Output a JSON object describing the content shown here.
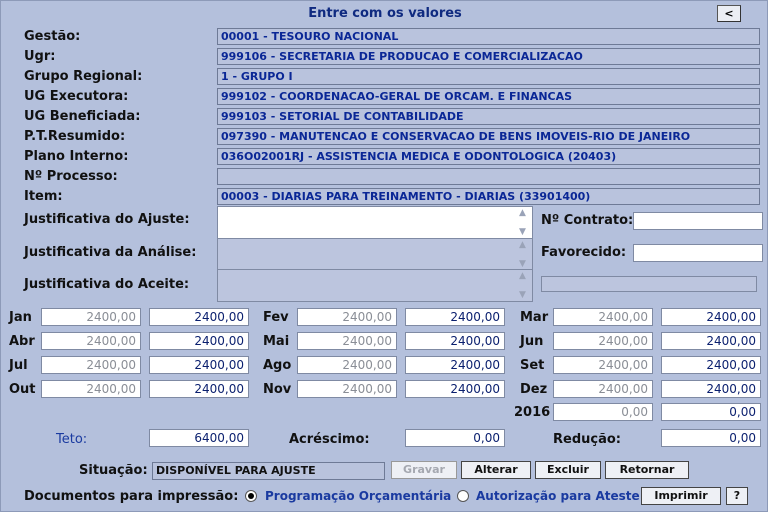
{
  "title": "Entre com os valores",
  "back_label": "<",
  "fields": [
    {
      "label": "Gestão:",
      "value": "00001 - TESOURO NACIONAL"
    },
    {
      "label": "Ugr:",
      "value": "999106 - SECRETARIA DE PRODUCAO E COMERCIALIZACAO"
    },
    {
      "label": "Grupo Regional:",
      "value": "1 - GRUPO I"
    },
    {
      "label": "UG Executora:",
      "value": "999102 - COORDENACAO-GERAL DE ORCAM. E FINANCAS"
    },
    {
      "label": "UG Beneficiada:",
      "value": "999103 - SETORIAL DE CONTABILIDADE"
    },
    {
      "label": "P.T.Resumido:",
      "value": "097390 - MANUTENCAO E CONSERVACAO DE BENS IMOVEIS-RIO DE JANEIRO"
    },
    {
      "label": "Plano Interno:",
      "value": "036O02001RJ - ASSISTENCIA MEDICA E ODONTOLOGICA (20403)"
    },
    {
      "label": "Nº Processo:",
      "value": ""
    },
    {
      "label": "Item:",
      "value": "00003 - DIARIAS PARA TREINAMENTO - DIARIAS (33901400)"
    }
  ],
  "justificativas": {
    "ajuste_label": "Justificativa do Ajuste:",
    "analise_label": "Justificativa da Análise:",
    "aceite_label": "Justificativa do Aceite:"
  },
  "contrato_label": "Nº Contrato:",
  "favorecido_label": "Favorecido:",
  "months": [
    {
      "label": "Jan",
      "prev": "2400,00",
      "value": "2400,00"
    },
    {
      "label": "Fev",
      "prev": "2400,00",
      "value": "2400,00"
    },
    {
      "label": "Mar",
      "prev": "2400,00",
      "value": "2400,00"
    },
    {
      "label": "Abr",
      "prev": "2400,00",
      "value": "2400,00"
    },
    {
      "label": "Mai",
      "prev": "2400,00",
      "value": "2400,00"
    },
    {
      "label": "Jun",
      "prev": "2400,00",
      "value": "2400,00"
    },
    {
      "label": "Jul",
      "prev": "2400,00",
      "value": "2400,00"
    },
    {
      "label": "Ago",
      "prev": "2400,00",
      "value": "2400,00"
    },
    {
      "label": "Set",
      "prev": "2400,00",
      "value": "2400,00"
    },
    {
      "label": "Out",
      "prev": "2400,00",
      "value": "2400,00"
    },
    {
      "label": "Nov",
      "prev": "2400,00",
      "value": "2400,00"
    },
    {
      "label": "Dez",
      "prev": "2400,00",
      "value": "2400,00"
    },
    {
      "label": "2016",
      "prev": "0,00",
      "value": "0,00"
    }
  ],
  "totals": {
    "teto_label": "Teto:",
    "teto_value": "6400,00",
    "acrescimo_label": "Acréscimo:",
    "acrescimo_value": "0,00",
    "reducao_label": "Redução:",
    "reducao_value": "0,00"
  },
  "situacao": {
    "label": "Situação:",
    "value": "DISPONÍVEL PARA AJUSTE"
  },
  "buttons": {
    "gravar": "Gravar",
    "alterar": "Alterar",
    "excluir": "Excluir",
    "retornar": "Retornar",
    "imprimir": "Imprimir",
    "help": "?"
  },
  "documentos": {
    "label": "Documentos para impressão:",
    "option1": "Programação Orçamentária",
    "option2": "Autorização para Ateste"
  },
  "colors": {
    "background": "#b4c0dc",
    "accent": "#1a3aa0"
  }
}
